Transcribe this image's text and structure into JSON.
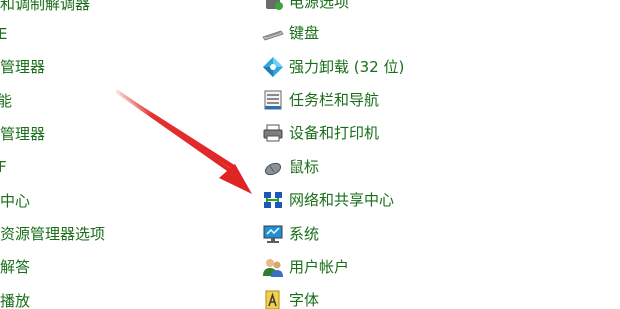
{
  "control_panel": {
    "left_items": [
      {
        "label": "和调制解调器"
      },
      {
        "label": "E"
      },
      {
        "label": "管理器"
      },
      {
        "label": "能"
      },
      {
        "label": "管理器"
      },
      {
        "label": "F"
      },
      {
        "label": "中心"
      },
      {
        "label": "资源管理器选项"
      },
      {
        "label": "解答"
      },
      {
        "label": "播放"
      }
    ],
    "right_items": [
      {
        "label": "电源选项",
        "icon": "power-options-icon"
      },
      {
        "label": "键盘",
        "icon": "keyboard-icon"
      },
      {
        "label": "强力卸载 (32 位)",
        "icon": "uninstaller-icon"
      },
      {
        "label": "任务栏和导航",
        "icon": "taskbar-icon"
      },
      {
        "label": "设备和打印机",
        "icon": "printer-icon"
      },
      {
        "label": "鼠标",
        "icon": "mouse-icon"
      },
      {
        "label": "网络和共享中心",
        "icon": "network-icon"
      },
      {
        "label": "系统",
        "icon": "system-monitor-icon"
      },
      {
        "label": "用户帐户",
        "icon": "user-accounts-icon"
      },
      {
        "label": "字体",
        "icon": "fonts-icon"
      }
    ]
  },
  "colors": {
    "link_text": "#1a6e1a",
    "arrow": "#e53030"
  }
}
